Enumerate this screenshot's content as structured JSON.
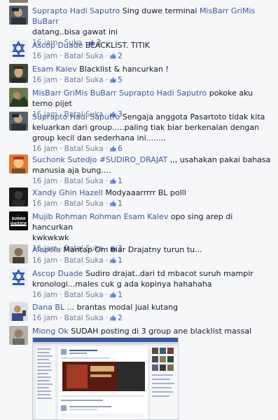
{
  "comments": [
    {
      "name": "Suprapto Hadi Saputro",
      "tag": "MisBarr GriMis BuBarr",
      "text": "Sing duwe terminal",
      "text2": "datang..bisa gawat ini",
      "time": "16 jam",
      "action": "Suka",
      "likes": "3"
    },
    {
      "name": "Ascop Duade",
      "text": "BLACKLIST. TITIK",
      "time": "16 jam",
      "action": "Batal Suka",
      "likes": "2"
    },
    {
      "name": "Esam Kalev",
      "text": "Blacklist & hancurkan !",
      "time": "16 jam",
      "action": "Batal Suka",
      "likes": "5"
    },
    {
      "name": "MisBarr GriMis BuBarr",
      "tag": "Suprapto Hadi Saputro",
      "text": "pokoke aku terno pijet",
      "time": "16 jam",
      "action": "Batal Suka",
      "likes": "3"
    },
    {
      "name": "Suprapto Hadi Saputro",
      "text": "Sengaja anggota Pasartoto tidak kita keluarkan dari group.....paling tiak biar berkenalan dengan group kecil dan sederhana ini........",
      "time": "16 jam",
      "action": "Batal Suka",
      "likes": "6"
    },
    {
      "name": "Suchonk Sutedjo",
      "tag": "#SUDIRO_DRAJAT",
      "text": ",,, usahakan pakai bahasa manusia aja bung....",
      "time": "16 jam",
      "action": "Batal Suka",
      "likes": "1"
    },
    {
      "name": "Xandy Ghin Hazell",
      "text": "Modyaaarrrrr BL polll",
      "time": "16 jam",
      "action": "Batal Suka",
      "likes": "1"
    },
    {
      "name": "Mujib Rohman Rohman",
      "tag": "Esam Kalev",
      "text": "opo sing arep di hancurkan",
      "text2": "kwkwkwk",
      "time": "16 jam",
      "action": "Batal Suka",
      "likes": "3"
    },
    {
      "name": "Alapola",
      "text": "Mantap Om biar Drajatny turun tu...",
      "time": "16 jam",
      "action": "Batal Suka",
      "likes": "1"
    },
    {
      "name": "Ascop Duade",
      "text": "Sudiro drajat..dari td mbacot suruh mampir kronologi...males cuk g ada kopinya hahahaha",
      "time": "16 jam",
      "action": "Batal Suka",
      "likes": "1"
    },
    {
      "name": "Dana BL",
      "text": "... brantas modal jual kutang",
      "time": "16 jam",
      "action": "Batal Suka",
      "likes": "2"
    },
    {
      "name": "Miong Ok",
      "text": "SUDAH posting di 3 group ane blacklist massal"
    }
  ],
  "avatar_sign": {
    "line1": "...",
    "line2": "SUDAH",
    "line3": "SENANG"
  },
  "colors": {
    "link": "#3b5998",
    "meta": "#6f7c96",
    "bg": "#f6f7f9"
  }
}
